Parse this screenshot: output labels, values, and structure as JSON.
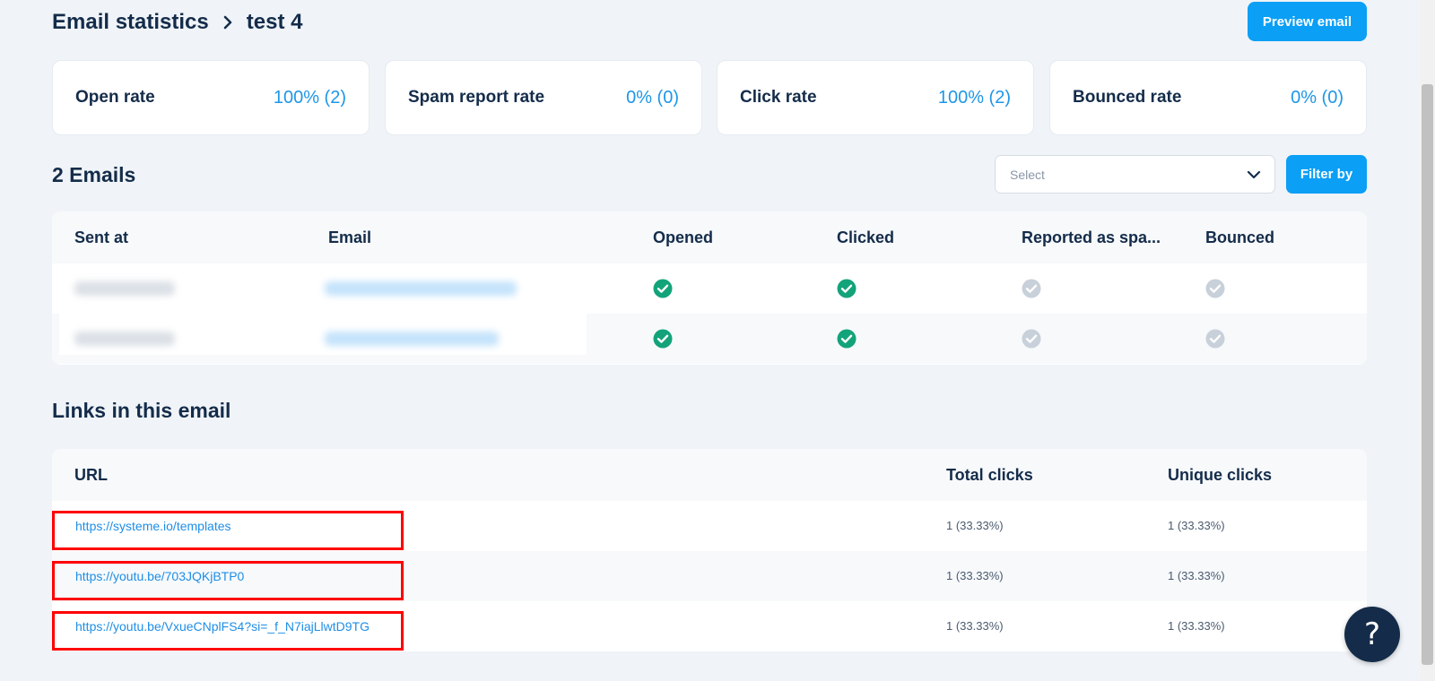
{
  "header": {
    "breadcrumb_root": "Email statistics",
    "breadcrumb_current": "test 4",
    "preview_label": "Preview email"
  },
  "stats": [
    {
      "label": "Open rate",
      "value": "100% (2)"
    },
    {
      "label": "Spam report rate",
      "value": "0% (0)"
    },
    {
      "label": "Click rate",
      "value": "100% (2)"
    },
    {
      "label": "Bounced rate",
      "value": "0% (0)"
    }
  ],
  "emails": {
    "title": "2 Emails",
    "select_placeholder": "Select",
    "filter_label": "Filter by",
    "columns": [
      "Sent at",
      "Email",
      "Opened",
      "Clicked",
      "Reported as spa...",
      "Bounced"
    ],
    "rows": [
      {
        "opened": true,
        "clicked": true,
        "spam": false,
        "bounced": false
      },
      {
        "opened": true,
        "clicked": true,
        "spam": false,
        "bounced": false
      }
    ]
  },
  "links": {
    "title": "Links in this email",
    "columns": [
      "URL",
      "Total clicks",
      "Unique clicks"
    ],
    "rows": [
      {
        "url": "https://systeme.io/templates",
        "total": "1 (33.33%)",
        "unique": "1 (33.33%)"
      },
      {
        "url": "https://youtu.be/703JQKjBTP0",
        "total": "1 (33.33%)",
        "unique": "1 (33.33%)"
      },
      {
        "url": "https://youtu.be/VxueCNplFS4?si=_f_N7iajLlwtD9TG",
        "total": "1 (33.33%)",
        "unique": "1 (33.33%)"
      }
    ]
  },
  "help": {
    "label": "?"
  },
  "colors": {
    "accent": "#0b9ff5",
    "check_active": "#13a37a",
    "check_inactive": "#c8d0da",
    "highlight": "#ff0000"
  }
}
